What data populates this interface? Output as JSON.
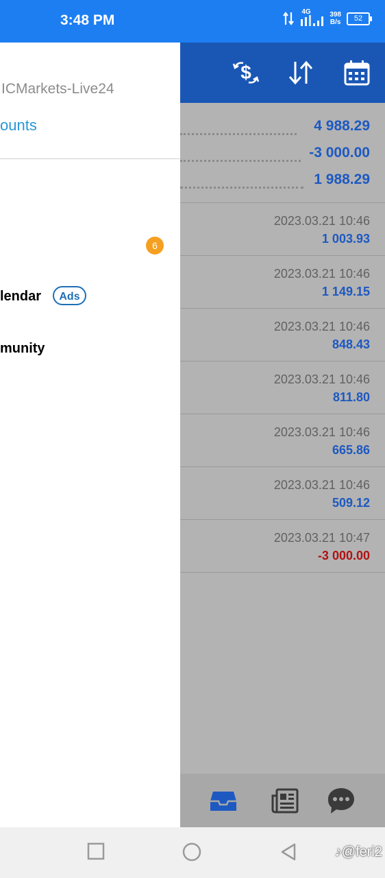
{
  "status_bar": {
    "time": "3:48 PM",
    "network_type": "4G",
    "speed_value": "398",
    "speed_unit": "B/s",
    "battery": "52"
  },
  "drawer": {
    "server": "ICMarkets-Live24",
    "accounts_link": "ounts",
    "notification_count": "6",
    "menu": [
      {
        "label": "lendar",
        "badge": "Ads"
      },
      {
        "label": "munity"
      }
    ]
  },
  "summary": [
    {
      "value": "4 988.29"
    },
    {
      "value": "-3 000.00"
    },
    {
      "value": "1 988.29"
    }
  ],
  "deals": [
    {
      "time": "2023.03.21 10:46",
      "amount": "1 003.93",
      "negative": false
    },
    {
      "time": "2023.03.21 10:46",
      "amount": "1 149.15",
      "negative": false
    },
    {
      "time": "2023.03.21 10:46",
      "amount": "848.43",
      "negative": false
    },
    {
      "time": "2023.03.21 10:46",
      "amount": "811.80",
      "negative": false
    },
    {
      "time": "2023.03.21 10:46",
      "amount": "665.86",
      "negative": false
    },
    {
      "time": "2023.03.21 10:46",
      "amount": "509.12",
      "negative": false
    },
    {
      "time": "2023.03.21 10:47",
      "amount": "-3 000.00",
      "negative": true
    }
  ],
  "toolbar_icons": [
    "deposit-withdraw-icon",
    "sort-icon",
    "calendar-icon"
  ],
  "bottom_nav_icons": [
    "inbox-icon",
    "news-icon",
    "chat-icon"
  ],
  "watermark": "♪@feri2",
  "colors": {
    "status_bar": "#1d7ef2",
    "toolbar": "#1a57b5",
    "positive": "#1d59c1",
    "negative": "#b01212",
    "badge": "#f5a020",
    "link": "#2a96d6"
  }
}
